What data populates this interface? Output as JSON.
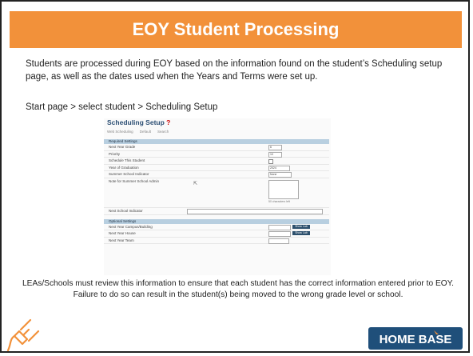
{
  "slide": {
    "title": "EOY Student Processing",
    "intro": "Students are processed during EOY based on the information found on the student’s Scheduling setup page, as well as the dates used when the Years and Terms were set up.",
    "nav_path": "Start page > select student > Scheduling Setup",
    "footer_text": "LEAs/Schools must review this information to ensure that each student has the correct information entered prior to EOY. Failure to do so can result in the student(s) being moved to the wrong grade level or school.",
    "logo_text": "HOME BASE"
  },
  "screenshot": {
    "title": "Scheduling Setup",
    "required_marker": "?",
    "tabs": [
      "Web Scheduling",
      "Default",
      "Search"
    ],
    "required_section": "Required Settings",
    "rows": {
      "next_year_grade": {
        "label": "Next Year Grade",
        "value": "6"
      },
      "priority": {
        "label": "Priority",
        "value": "10"
      },
      "schedule_student": {
        "label": "Schedule This Student"
      },
      "year_of_graduation": {
        "label": "Year of Graduation",
        "value": "2024"
      },
      "summer_school_indicator": {
        "label": "Summer School Indicator",
        "value": "None"
      },
      "summer_school_notes": {
        "label": "Note for Summer School Admin",
        "counter": "50 characters left"
      },
      "next_school_indicator": {
        "label": "Next School Indicator"
      }
    },
    "optional_section": "Optional Settings",
    "optional_rows": {
      "next_year_campus": {
        "label": "Next Year Campus/Building",
        "button": "Show Lab"
      },
      "next_year_house": {
        "label": "Next Year House",
        "button": "Show Lab"
      },
      "next_year_team": {
        "label": "Next Year Team"
      }
    }
  },
  "colors": {
    "title_bar": "#f2913a",
    "section_header": "#b8cfe0",
    "button": "#2c4f6c",
    "logo_bg": "#1f4f7a",
    "logo_accent": "#f2913a"
  }
}
